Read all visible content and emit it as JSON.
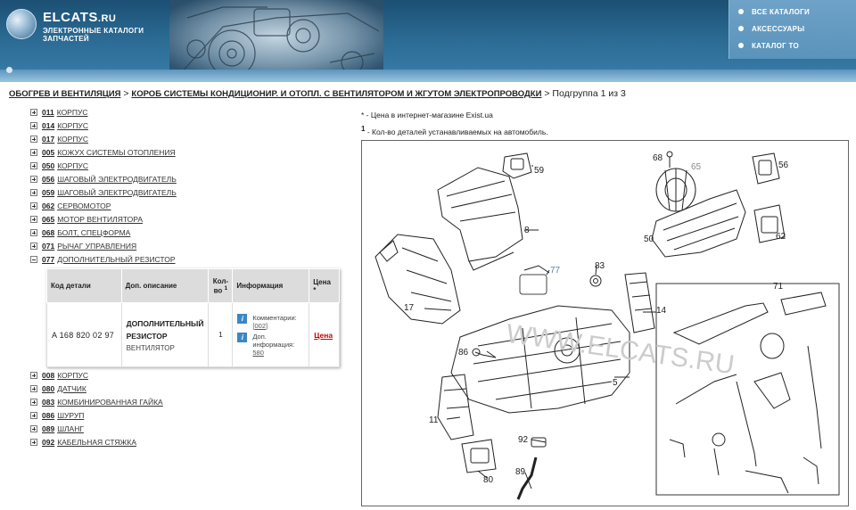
{
  "header": {
    "logo_title": "ELCATS",
    "logo_tld": ".RU",
    "logo_sub1": "ЭЛЕКТРОННЫЕ КАТАЛОГИ",
    "logo_sub2": "ЗАПЧАСТЕЙ",
    "nav": [
      "ВСЕ КАТАЛОГИ",
      "АКСЕССУАРЫ",
      "КАТАЛОГ ТО"
    ]
  },
  "breadcrumb": {
    "level1": "ОБОГРЕВ И ВЕНТИЛЯЦИЯ",
    "sep": ">",
    "level2": "КОРОБ СИСТЕМЫ КОНДИЦИОНИР. И ОТОПЛ. С ВЕНТИЛЯТОРОМ И ЖГУТОМ ЭЛЕКТРОПРОВОДКИ",
    "suffix": "> Подгруппа 1 из 3"
  },
  "tree_before": [
    {
      "code": "011",
      "name": "КОРПУС"
    },
    {
      "code": "014",
      "name": "КОРПУС"
    },
    {
      "code": "017",
      "name": "КОРПУС"
    },
    {
      "code": "005",
      "name": "КОЖУХ СИСТЕМЫ ОТОПЛЕНИЯ"
    },
    {
      "code": "050",
      "name": "КОРПУС"
    },
    {
      "code": "056",
      "name": "ШАГОВЫЙ ЭЛЕКТРОДВИГАТЕЛЬ"
    },
    {
      "code": "059",
      "name": "ШАГОВЫЙ ЭЛЕКТРОДВИГАТЕЛЬ"
    },
    {
      "code": "062",
      "name": "СЕРВОМОТОР"
    },
    {
      "code": "065",
      "name": "МОТОР ВЕНТИЛЯТОРА"
    },
    {
      "code": "068",
      "name": "БОЛТ, СПЕЦФОРМА"
    },
    {
      "code": "071",
      "name": "РЫЧАГ УПРАВЛЕНИЯ"
    }
  ],
  "tree_open": {
    "code": "077",
    "name": "ДОПОЛНИТЕЛЬНЫЙ РЕЗИСТОР"
  },
  "detail": {
    "headers": {
      "code": "Код детали",
      "desc": "Доп. описание",
      "qty": "Кол-во",
      "qty_sup": "1",
      "info": "Информация",
      "price": "Цена",
      "price_sup": "*"
    },
    "part_no": "A  168 820 02 97",
    "desc_main": "ДОПОЛНИТЕЛЬНЫЙ РЕЗИСТОР",
    "desc_sub": "ВЕНТИЛЯТОР",
    "qty": "1",
    "comment_label": "Комментарии:",
    "comment_value": "[002]",
    "extra_label": "Доп. информация:",
    "extra_value": "580",
    "price_link": "Цена"
  },
  "tree_after": [
    {
      "code": "008",
      "name": "КОРПУС"
    },
    {
      "code": "080",
      "name": "ДАТЧИК"
    },
    {
      "code": "083",
      "name": "КОМБИНИРОВАННАЯ ГАЙКА"
    },
    {
      "code": "086",
      "name": "ШУРУП"
    },
    {
      "code": "089",
      "name": "ШЛАНГ"
    },
    {
      "code": "092",
      "name": "КАБЕЛЬНАЯ СТЯЖКА"
    }
  ],
  "legend": {
    "line1": "* - Цена в интернет-магазине Exist.ua",
    "line2_sup": "1",
    "line2": " - Кол-во деталей устанавливаемых на автомобиль."
  },
  "diagram": {
    "watermark": "WWW.ELCATS.RU",
    "callouts": [
      "59",
      "68",
      "65",
      "56",
      "8",
      "50",
      "62",
      "77",
      "83",
      "71",
      "17",
      "14",
      "86",
      "5",
      "11",
      "92",
      "89",
      "80"
    ],
    "highlighted": "77"
  }
}
